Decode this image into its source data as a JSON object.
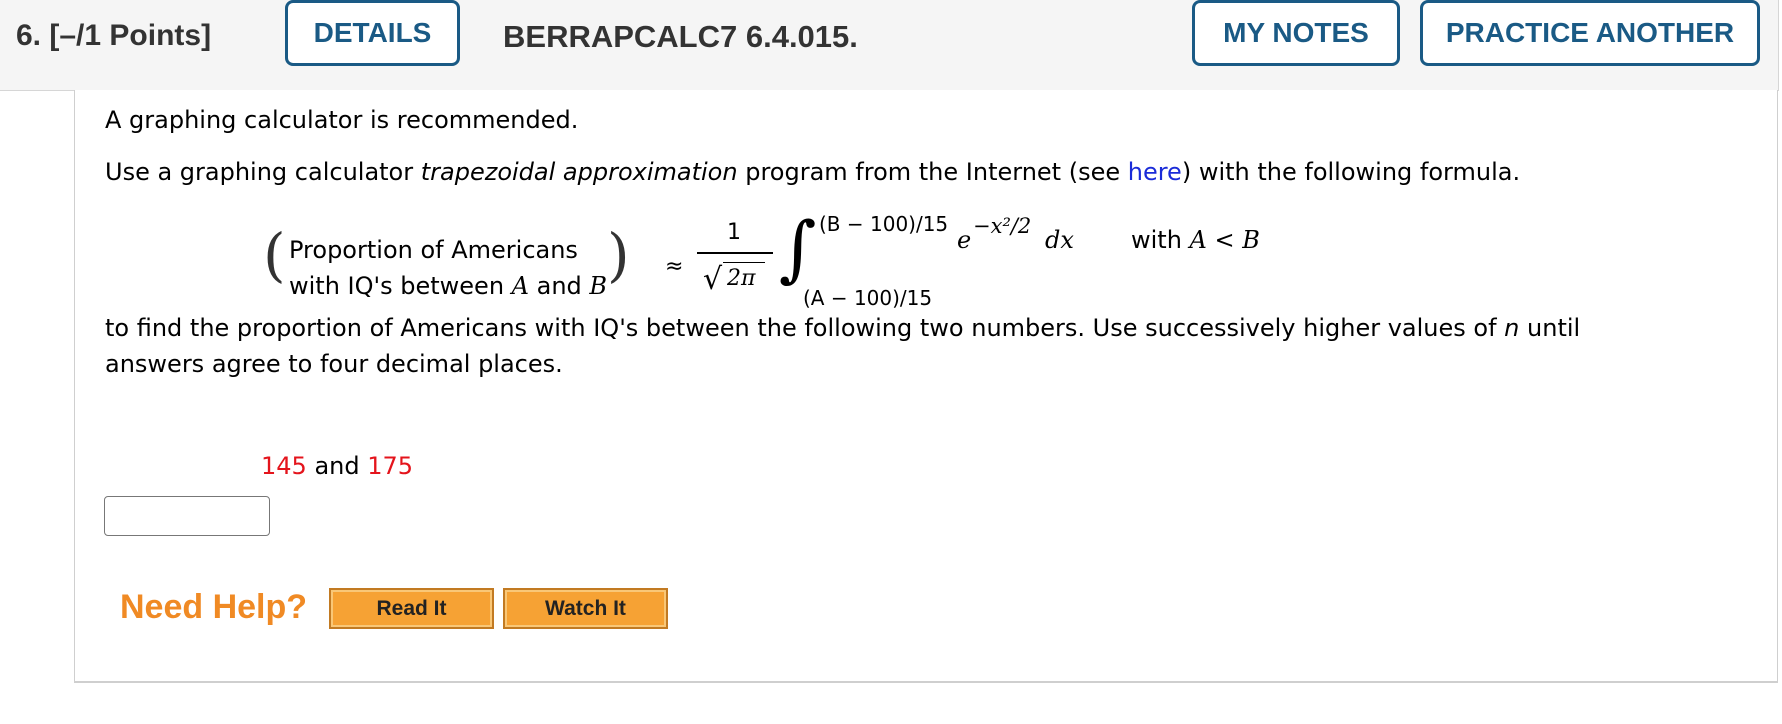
{
  "header": {
    "question_number": "6.",
    "points": "[–/1 Points]",
    "details_label": "DETAILS",
    "problem_id": "BERRAPCALC7 6.4.015.",
    "my_notes_label": "MY NOTES",
    "practice_another_label": "PRACTICE ANOTHER"
  },
  "body": {
    "line1": "A graphing calculator is recommended.",
    "line2_pre": "Use a graphing calculator ",
    "line2_italic": "trapezoidal approximation",
    "line2_mid": " program from the Internet (see ",
    "line2_link": "here",
    "line2_post": ") with the following formula.",
    "formula": {
      "paren_line1": "Proportion of Americans",
      "paren_line2_pre": "with IQ's between ",
      "paren_var_a": "A",
      "paren_and": " and ",
      "paren_var_b": "B",
      "approx": "≈",
      "numerator": "1",
      "denominator": "2π",
      "upper_limit": "(B − 100)/15",
      "lower_limit": "(A − 100)/15",
      "integrand_base": "e",
      "integrand_exp": "−x²/2",
      "dx": "dx",
      "condition_pre": "with ",
      "condition_expr": "A < B"
    },
    "line3": "to find the proportion of Americans with IQ's between the following two numbers. Use successively higher values of ",
    "line3_var": "n",
    "line3_end": " until",
    "line4": "answers agree to four decimal places.",
    "value_a": "145",
    "value_and": " and ",
    "value_b": "175"
  },
  "help": {
    "title": "Need Help?",
    "read_it": "Read It",
    "watch_it": "Watch It"
  },
  "colors": {
    "accent": "#1a5a85",
    "link": "#1a2bd8",
    "highlight": "#e4141c",
    "help": "#f08a24"
  }
}
